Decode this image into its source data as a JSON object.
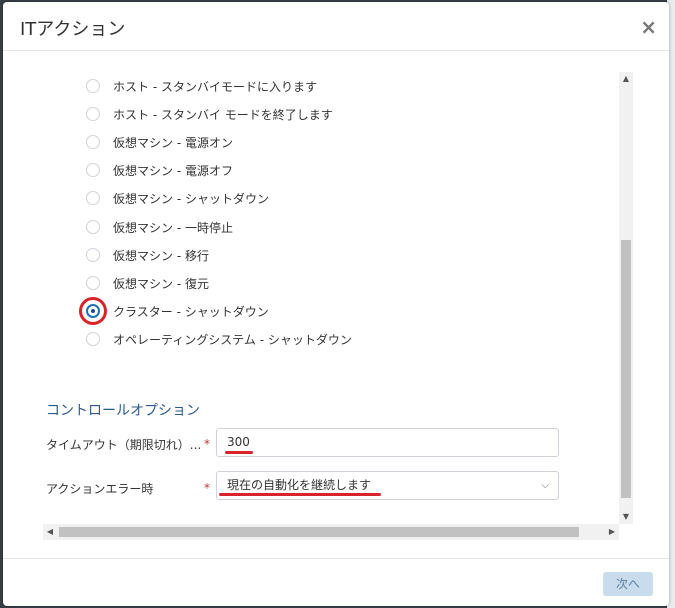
{
  "dialog": {
    "title": "ITアクション",
    "close_glyph": "×"
  },
  "actions": [
    {
      "label": "ホスト - スタンバイモードに入ります",
      "checked": false
    },
    {
      "label": "ホスト - スタンバイ モードを終了します",
      "checked": false
    },
    {
      "label": "仮想マシン - 電源オン",
      "checked": false
    },
    {
      "label": "仮想マシン - 電源オフ",
      "checked": false
    },
    {
      "label": "仮想マシン - シャットダウン",
      "checked": false
    },
    {
      "label": "仮想マシン - 一時停止",
      "checked": false
    },
    {
      "label": "仮想マシン - 移行",
      "checked": false
    },
    {
      "label": "仮想マシン - 復元",
      "checked": false
    },
    {
      "label": "クラスター - シャットダウン",
      "checked": true
    },
    {
      "label": "オペレーティングシステム - シャットダウン",
      "checked": false
    }
  ],
  "control_options": {
    "title": "コントロールオプション",
    "timeout_label": "タイムアウト（期限切れ）...",
    "timeout_value": "300",
    "action_error_label": "アクションエラー時",
    "action_error_value": "現在の自動化を継続します",
    "required_mark": "*"
  },
  "footer": {
    "next_label": "次へ"
  },
  "colors": {
    "accent": "#1f6fb5",
    "annotation": "#d8232a",
    "section_title": "#2c5a8c"
  }
}
